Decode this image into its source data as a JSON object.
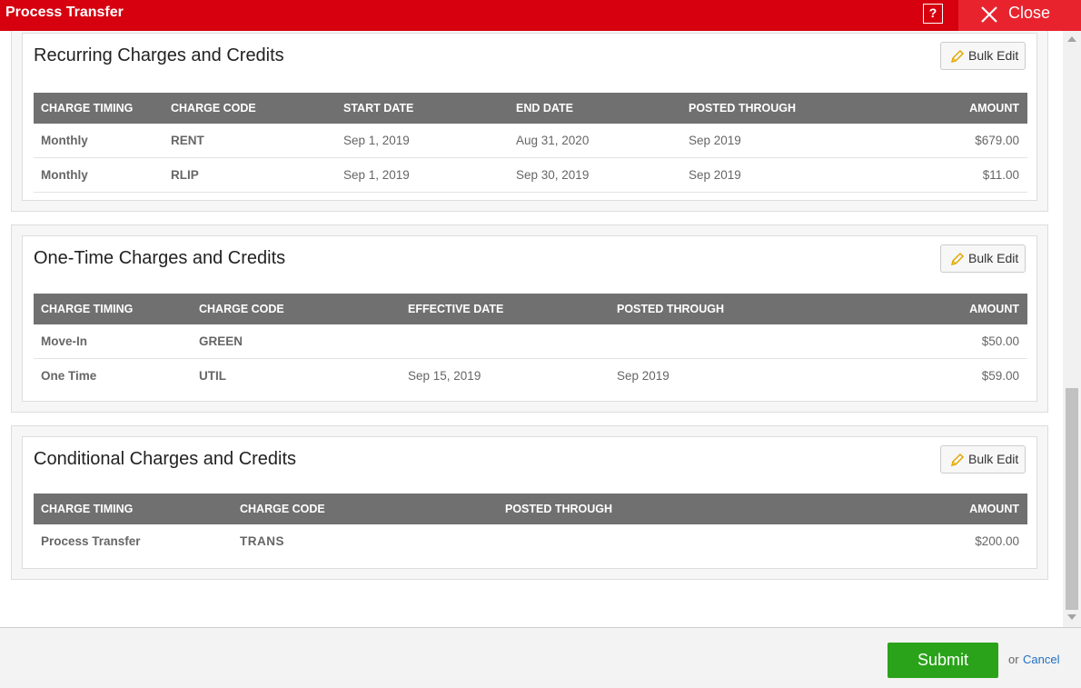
{
  "dialog": {
    "title": "Process Transfer",
    "help_label": "?",
    "close_label": "Close"
  },
  "sections": [
    {
      "title": "Recurring Charges and Credits",
      "bulk_edit_label": "Bulk Edit",
      "columns": [
        "CHARGE TIMING",
        "CHARGE CODE",
        "START DATE",
        "END DATE",
        "POSTED THROUGH",
        "AMOUNT"
      ],
      "rows": [
        [
          "Monthly",
          "RENT",
          "Sep 1, 2019",
          "Aug 31, 2020",
          "Sep 2019",
          "$679.00"
        ],
        [
          "Monthly",
          "RLIP",
          "Sep 1, 2019",
          "Sep 30, 2019",
          "Sep 2019",
          "$11.00"
        ]
      ]
    },
    {
      "title": "One-Time Charges and Credits",
      "bulk_edit_label": "Bulk Edit",
      "columns": [
        "CHARGE TIMING",
        "CHARGE CODE",
        "EFFECTIVE DATE",
        "POSTED THROUGH",
        "AMOUNT"
      ],
      "rows": [
        [
          "Move-In",
          "GREEN",
          "",
          "",
          "$50.00"
        ],
        [
          "One Time",
          "UTIL",
          "Sep 15, 2019",
          "Sep 2019",
          "$59.00"
        ]
      ]
    },
    {
      "title": "Conditional Charges and Credits",
      "bulk_edit_label": "Bulk Edit",
      "columns": [
        "CHARGE TIMING",
        "CHARGE CODE",
        "POSTED THROUGH",
        "AMOUNT"
      ],
      "rows": [
        [
          "Process Transfer",
          "TRANS",
          "",
          "$200.00"
        ]
      ]
    }
  ],
  "footer": {
    "submit_label": "Submit",
    "or_label": "or",
    "cancel_label": "Cancel"
  },
  "colors": {
    "titlebar": "#d6000f",
    "table_header": "#707070",
    "submit": "#2aa31a",
    "link": "#1f6fc5"
  }
}
